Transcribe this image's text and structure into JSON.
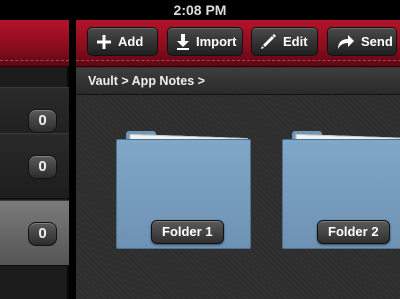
{
  "status_bar": {
    "time": "2:08 PM"
  },
  "sidebar": {
    "rows": [
      {
        "count": "0",
        "selected": false
      },
      {
        "count": "0",
        "selected": false
      },
      {
        "count": "0",
        "selected": true
      }
    ]
  },
  "toolbar": {
    "add_label": "Add",
    "import_label": "Import",
    "edit_label": "Edit",
    "send_label": "Send"
  },
  "breadcrumb": "Vault > App Notes >",
  "folders": [
    {
      "label": "Folder 1"
    },
    {
      "label": "Folder 2"
    }
  ],
  "colors": {
    "toolbar_red": "#8d0d1f",
    "folder_blue": "#7a9fc1",
    "background": "#2e2e2e"
  }
}
